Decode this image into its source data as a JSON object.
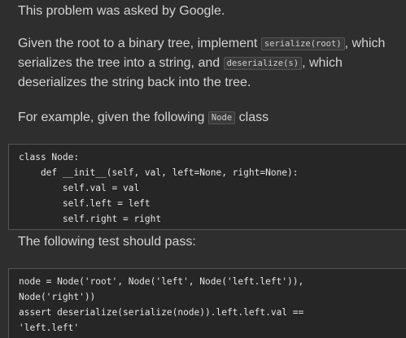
{
  "intro": "This problem was asked by Google.",
  "problem": {
    "line1_before": "Given the root to a binary tree, implement ",
    "serialize_code": "serialize(root)",
    "line1_after": ", which",
    "line2_before": "serializes the tree into a string, and ",
    "deserialize_code": "deserialize(s)",
    "line2_after": ", which",
    "line3": "deserializes the string back into the tree."
  },
  "example": {
    "before": "For example, given the following ",
    "code": "Node",
    "after": " class"
  },
  "node_class_code": [
    "class Node:",
    "    def __init__(self, val, left=None, right=None):",
    "        self.val = val",
    "        self.left = left",
    "        self.right = right"
  ],
  "test_intro": "The following test should pass:",
  "test_code": [
    "node = Node('root', Node('left', Node('left.left')),",
    "Node('right'))",
    "assert deserialize(serialize(node)).left.left.val ==",
    "'left.left'"
  ]
}
